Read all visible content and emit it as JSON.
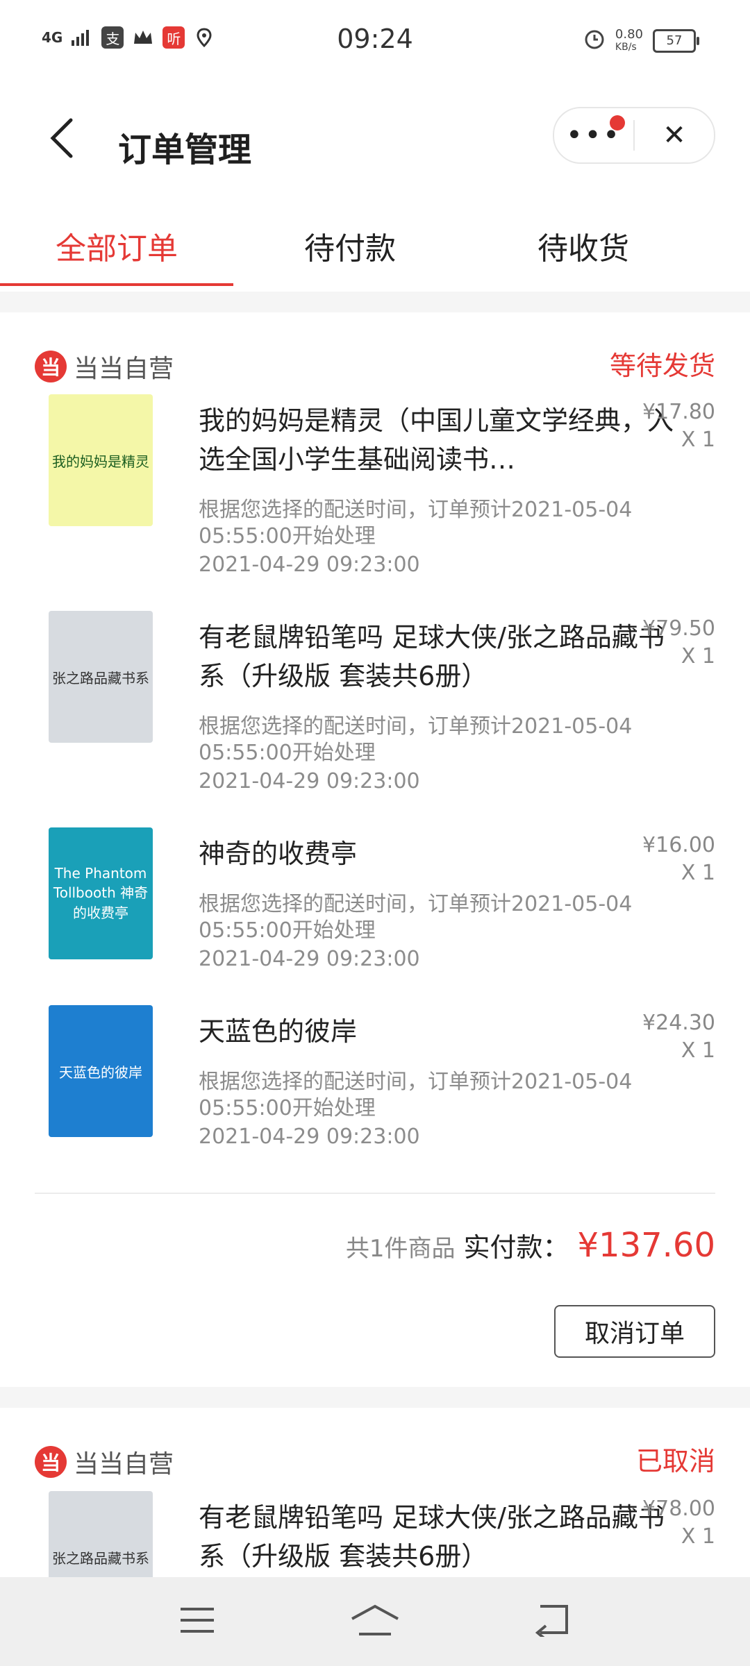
{
  "status_bar": {
    "network": "4G",
    "time": "09:24",
    "speed_value": "0.80",
    "speed_unit": "KB/s",
    "battery": "57"
  },
  "header": {
    "title": "订单管理",
    "more_label": "•••",
    "close_label": "✕"
  },
  "tabs": [
    {
      "label": "全部订单",
      "active": true
    },
    {
      "label": "待付款",
      "active": false
    },
    {
      "label": "待收货",
      "active": false
    }
  ],
  "orders": [
    {
      "shop": "当当自营",
      "shop_logo": "当",
      "status": "等待发货",
      "items": [
        {
          "title": "我的妈妈是精灵（中国儿童文学经典，入选全国小学生基础阅读书…",
          "price": "¥17.80",
          "qty": "X 1",
          "note_line1": "根据您选择的配送时间，订单预计2021-05-04",
          "note_line2": "05:55:00开始处理",
          "date": "2021-04-29 09:23:00",
          "cover_color": "#f4f7a8",
          "cover_text": "我的妈妈是精灵"
        },
        {
          "title": "有老鼠牌铅笔吗 足球大侠/张之路品藏书系（升级版 套装共6册）",
          "price": "¥79.50",
          "qty": "X 1",
          "note_line1": "根据您选择的配送时间，订单预计2021-05-04",
          "note_line2": "05:55:00开始处理",
          "date": "2021-04-29 09:23:00",
          "cover_color": "#d7dbe0",
          "cover_text": "张之路品藏书系"
        },
        {
          "title": "神奇的收费亭",
          "price": "¥16.00",
          "qty": "X 1",
          "note_line1": "根据您选择的配送时间，订单预计2021-05-04",
          "note_line2": "05:55:00开始处理",
          "date": "2021-04-29 09:23:00",
          "cover_color": "#1aa0b8",
          "cover_text": "The Phantom Tollbooth 神奇的收费亭"
        },
        {
          "title": "天蓝色的彼岸",
          "price": "¥24.30",
          "qty": "X 1",
          "note_line1": "根据您选择的配送时间，订单预计2021-05-04",
          "note_line2": "05:55:00开始处理",
          "date": "2021-04-29 09:23:00",
          "cover_color": "#1e7fd0",
          "cover_text": "天蓝色的彼岸"
        }
      ],
      "total_count": "共1件商品",
      "paid_label": "实付款：",
      "paid_amount": "¥137.60",
      "action": "取消订单"
    },
    {
      "shop": "当当自营",
      "shop_logo": "当",
      "status": "已取消",
      "items": [
        {
          "title": "有老鼠牌铅笔吗 足球大侠/张之路品藏书系（升级版 套装共6册）",
          "price": "¥78.00",
          "qty": "X 1",
          "cover_color": "#d7dbe0",
          "cover_text": "张之路品藏书系"
        }
      ]
    }
  ],
  "colors": {
    "accent": "#e53935",
    "muted_text": "#8c8c8c"
  },
  "system_nav": [
    "menu-icon",
    "home-icon",
    "back-icon"
  ]
}
